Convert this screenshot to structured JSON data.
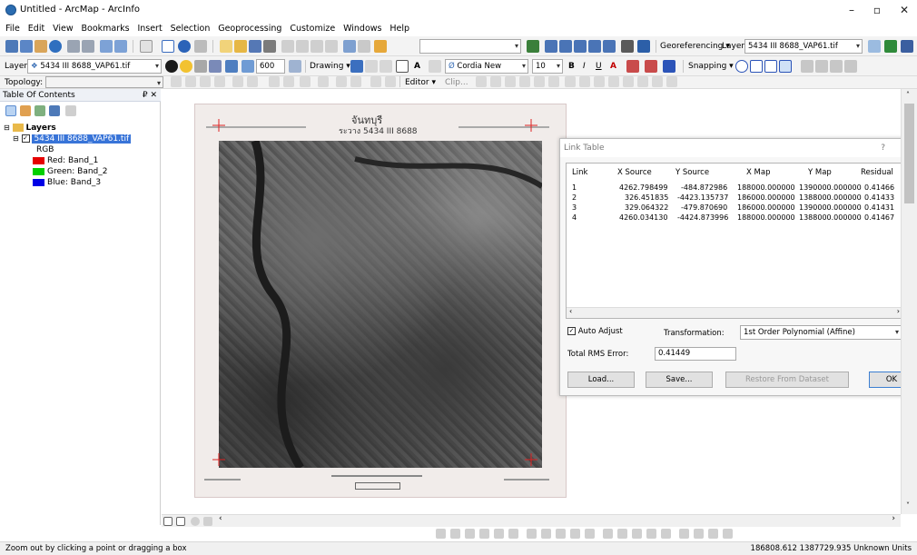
{
  "window": {
    "title": "Untitled - ArcMap - ArcInfo",
    "min": "–",
    "max": "▫",
    "close": "✕"
  },
  "menu": [
    "File",
    "Edit",
    "View",
    "Bookmarks",
    "Insert",
    "Selection",
    "Geoprocessing",
    "Customize",
    "Windows",
    "Help"
  ],
  "toolbar1": {
    "georeferencing_label": "Georeferencing ▾",
    "layer_label": "Layer:",
    "layer_value": "5434 III 8688_VAP61.tif"
  },
  "toolbar2": {
    "layer_label": "Layer:",
    "layer_value": "5434 III 8688_VAP61.tif",
    "zoom_value": "600",
    "drawing_label": "Drawing ▾",
    "font_value": "Cordia New",
    "fontsize_value": "10",
    "bold": "B",
    "italic": "I",
    "underline": "U",
    "text_a": "A",
    "snapping_label": "Snapping ▾"
  },
  "toolbar3": {
    "topology_label": "Topology:",
    "editor_label": "Editor ▾",
    "clip_label": "Clip..."
  },
  "toc": {
    "title": "Table Of Contents",
    "pin": "₽ ✕",
    "layers_label": "Layers",
    "layer_name": "5434 III 8688_VAP61.tif",
    "rgb_label": "RGB",
    "bands": [
      {
        "label": "Red:  Band_1",
        "color": "#e60000"
      },
      {
        "label": "Green: Band_2",
        "color": "#00d000"
      },
      {
        "label": "Blue:  Band_3",
        "color": "#0000e6"
      }
    ]
  },
  "map": {
    "sheet_title": "จันทบุรี",
    "sheet_subtitle": "ระวาง 5434 III 8688"
  },
  "link_table": {
    "title": "Link Table",
    "help": "?",
    "close": "✕",
    "columns": [
      "Link",
      "X Source",
      "Y Source",
      "X Map",
      "Y Map",
      "Residual"
    ],
    "rows": [
      [
        "1",
        "4262.798499",
        "-484.872986",
        "188000.000000",
        "1390000.000000",
        "0.41466"
      ],
      [
        "2",
        "326.451835",
        "-4423.135737",
        "186000.000000",
        "1388000.000000",
        "0.41433"
      ],
      [
        "3",
        "329.064322",
        "-479.870690",
        "186000.000000",
        "1390000.000000",
        "0.41431"
      ],
      [
        "4",
        "4260.034130",
        "-4424.873996",
        "188000.000000",
        "1388000.000000",
        "0.41467"
      ]
    ],
    "auto_adjust_label": "Auto Adjust",
    "transformation_label": "Transformation:",
    "transformation_value": "1st Order Polynomial (Affine)",
    "rms_label": "Total RMS Error:",
    "rms_value": "0.41449",
    "load_button": "Load...",
    "save_button": "Save...",
    "restore_button": "Restore From Dataset",
    "ok_button": "OK"
  },
  "status": {
    "hint": "Zoom out by clicking a point or dragging a box",
    "coords": "186808.612  1387729.935 Unknown Units"
  }
}
